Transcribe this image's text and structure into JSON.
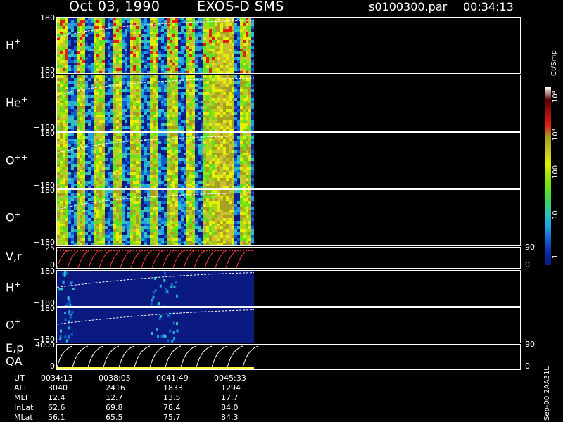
{
  "header": {
    "date": "Oct 03, 1990",
    "mission": "EXOS-D SMS",
    "file": "s0100300.par",
    "time": "00:34:13"
  },
  "colors": {
    "background": "#000000",
    "panel_fill": "#0a1a80",
    "axis": "#ffffff",
    "qa_bar": "#ffff40",
    "vr_trace": "#ff4030"
  },
  "panels": [
    {
      "label_main": "H",
      "label_sup": "+",
      "ytop": "180",
      "ybot": "−180"
    },
    {
      "label_main": "He",
      "label_sup": "+",
      "ytop": "180",
      "ybot": "−180"
    },
    {
      "label_main": "O",
      "label_sup": "++",
      "ytop": "180",
      "ybot": "−180"
    },
    {
      "label_main": "O",
      "label_sup": "+",
      "ytop": "180",
      "ybot": "−180"
    },
    {
      "label_main": "V,r",
      "label_sup": "",
      "ytop": "25",
      "ybot": "0",
      "rtop": "90",
      "rbot": "0"
    },
    {
      "label_main": "H",
      "label_sup": "+",
      "ytop": "180",
      "ybot": "−180"
    },
    {
      "label_main": "O",
      "label_sup": "+",
      "ytop": "180",
      "ybot": "−180"
    },
    {
      "label_main": "E,p",
      "label_sup": "",
      "label_extra": "QA",
      "ytop": "4000",
      "ybot": "0",
      "rtop": "90",
      "rbot": "0"
    }
  ],
  "colorbar": {
    "unit": "Ct/Smp",
    "labels": [
      "10⁴",
      "10³",
      "100",
      "10",
      "1"
    ]
  },
  "footer_tag": "Sep-00 2AA31L",
  "info_table": {
    "rows": [
      {
        "name": "UT",
        "values": [
          "0034:13",
          "0038:05",
          "0041:49",
          "0045:33"
        ]
      },
      {
        "name": "ALT",
        "values": [
          "3040",
          "2416",
          "1833",
          "1294"
        ]
      },
      {
        "name": "MLT",
        "values": [
          "12.4",
          "12.7",
          "13.5",
          "17.7"
        ]
      },
      {
        "name": "InLat",
        "values": [
          "62.6",
          "69.8",
          "78.4",
          "84.0"
        ]
      },
      {
        "name": "MLat",
        "values": [
          "56.1",
          "65.5",
          "75.7",
          "84.3"
        ]
      }
    ]
  },
  "chart_data": {
    "type": "heatmap",
    "x_ticks": [
      "0034:13",
      "0038:05",
      "0041:49",
      "0045:33"
    ],
    "panels": [
      "H+",
      "He+",
      "O++",
      "O+",
      "V,r",
      "H+",
      "O+",
      "E,p / QA"
    ],
    "ylim_pitch": [
      -180,
      180
    ],
    "ylim_vr": [
      0,
      25
    ],
    "ylim_ep": [
      0,
      4000
    ],
    "colorbar_range": [
      1,
      10000
    ],
    "colorbar_scale": "log",
    "grid": false
  }
}
